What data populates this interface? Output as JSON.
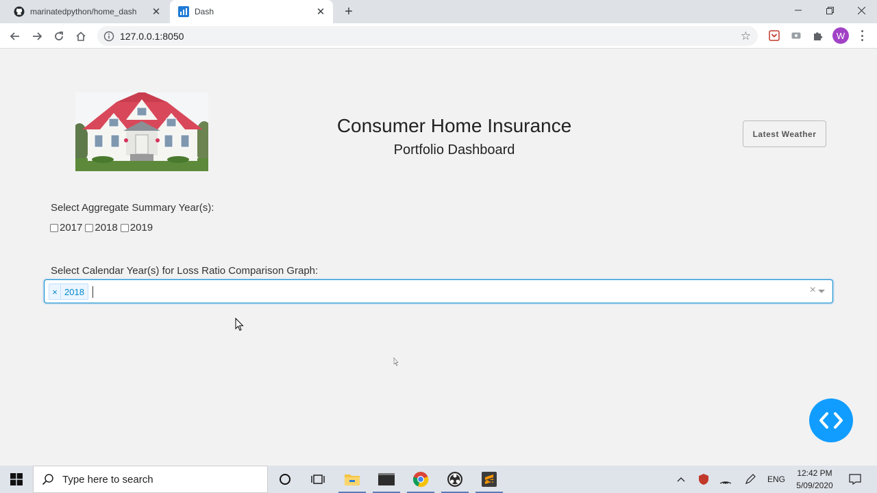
{
  "browser": {
    "tabs": [
      {
        "title": "marinatedpython/home_dash",
        "favicon": "github-icon"
      },
      {
        "title": "Dash",
        "favicon": "dash-chart-icon"
      }
    ],
    "url": "127.0.0.1:8050",
    "profile_initial": "W"
  },
  "header": {
    "title": "Consumer Home Insurance",
    "subtitle": "Portfolio Dashboard",
    "weather_button": "Latest Weather"
  },
  "summary_years": {
    "label": "Select Aggregate Summary Year(s):",
    "options": [
      {
        "label": "2017",
        "checked": false
      },
      {
        "label": "2018",
        "checked": false
      },
      {
        "label": "2019",
        "checked": false
      }
    ]
  },
  "loss_ratio": {
    "label": "Select Calendar Year(s) for Loss Ratio Comparison Graph:",
    "selected": [
      "2018"
    ],
    "chip_remove": "×",
    "clear": "×"
  },
  "taskbar": {
    "search_placeholder": "Type here to search",
    "language": "ENG",
    "time": "12:42 PM",
    "date": "5/09/2020"
  },
  "colors": {
    "accent": "#119dff",
    "select_border": "#0088cc",
    "chip_bg": "#ebf5ff"
  }
}
